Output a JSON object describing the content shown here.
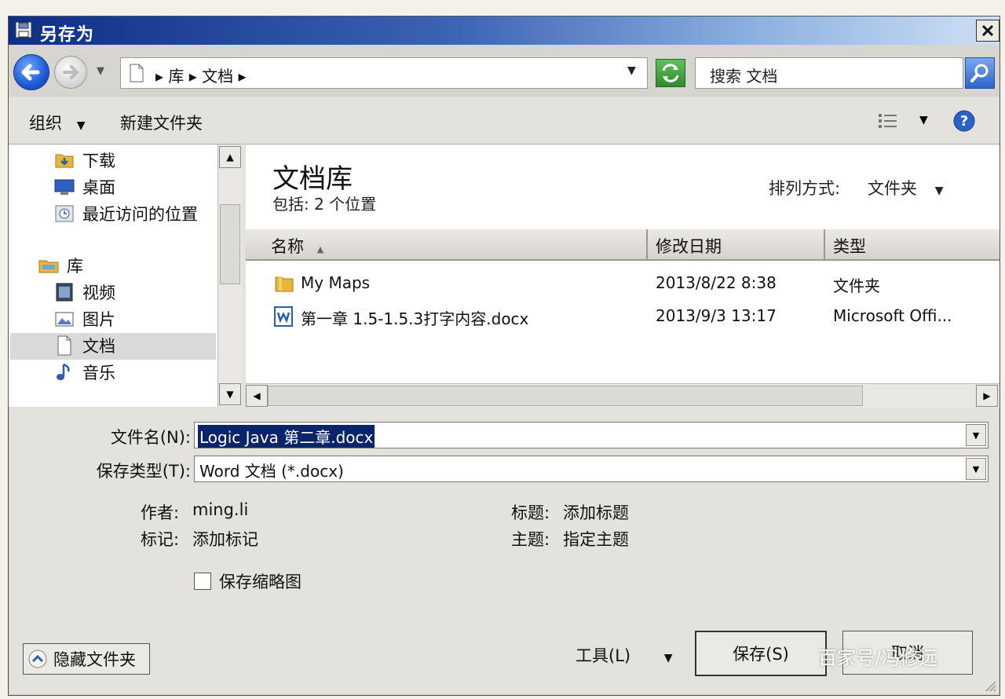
{
  "window": {
    "title": "另存为"
  },
  "nav": {
    "breadcrumb": "▸ 库 ▸ 文档 ▸",
    "search_placeholder": "搜索 文档"
  },
  "toolbar": {
    "organize": "组织",
    "new_folder": "新建文件夹"
  },
  "sidebar": {
    "items": [
      {
        "label": "下载",
        "icon": "download-folder-icon"
      },
      {
        "label": "桌面",
        "icon": "desktop-icon"
      },
      {
        "label": "最近访问的位置",
        "icon": "recent-places-icon"
      },
      {
        "label": "库",
        "icon": "libraries-icon"
      },
      {
        "label": "视频",
        "icon": "video-icon"
      },
      {
        "label": "图片",
        "icon": "pictures-icon"
      },
      {
        "label": "文档",
        "icon": "documents-icon",
        "selected": true
      },
      {
        "label": "音乐",
        "icon": "music-icon"
      }
    ]
  },
  "library": {
    "title": "文档库",
    "subtitle": "包括: 2 个位置",
    "sort_label": "排列方式:",
    "sort_value": "文件夹"
  },
  "table": {
    "columns": [
      "名称",
      "修改日期",
      "类型"
    ],
    "rows": [
      {
        "name": "My Maps",
        "date": "2013/8/22 8:38",
        "type": "文件夹",
        "icon": "folder-icon"
      },
      {
        "name": "第一章 1.5-1.5.3打字内容.docx",
        "date": "2013/9/3 13:17",
        "type": "Microsoft Offi...",
        "icon": "word-document-icon"
      }
    ]
  },
  "form": {
    "filename_label": "文件名(N):",
    "filename_value": "Logic Java 第二章.docx",
    "savetype_label": "保存类型(T):",
    "savetype_value": "Word 文档 (*.docx)",
    "author_label": "作者:",
    "author_value": "ming.li",
    "tags_label": "标记:",
    "tags_value": "添加标记",
    "title_label": "标题:",
    "title_value": "添加标题",
    "subject_label": "主题:",
    "subject_value": "指定主题",
    "thumbnail_label": "保存缩略图"
  },
  "buttons": {
    "hide_folders": "隐藏文件夹",
    "tools": "工具(L)",
    "save": "保存(S)",
    "cancel": "取消"
  },
  "watermark": "百家号/冯修远",
  "colors": {
    "title_bar_start": "#0d2f86",
    "title_bar_end": "#cfe0f5",
    "selection": "#0a246a"
  }
}
